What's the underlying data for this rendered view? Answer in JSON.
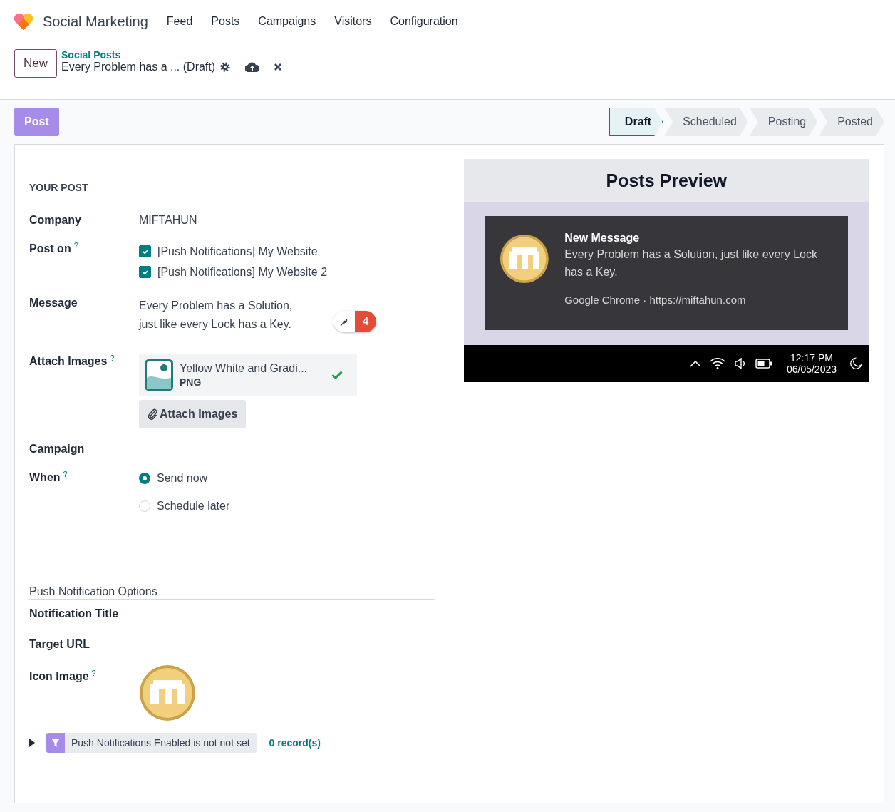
{
  "app": {
    "name": "Social Marketing",
    "menu": [
      "Feed",
      "Posts",
      "Campaigns",
      "Visitors",
      "Configuration"
    ]
  },
  "control_panel": {
    "new_button": "New",
    "breadcrumb": "Social Posts",
    "record_title": "Every Problem has a ... (Draft)"
  },
  "action_button": "Post",
  "stages": [
    {
      "label": "Draft",
      "selected": true
    },
    {
      "label": "Scheduled",
      "selected": false
    },
    {
      "label": "Posting",
      "selected": false
    },
    {
      "label": "Posted",
      "selected": false
    }
  ],
  "form": {
    "section_title": "YOUR POST",
    "company": {
      "label": "Company",
      "value": "MIFTAHUN"
    },
    "post_on": {
      "label": "Post on",
      "help": "?",
      "accounts": [
        {
          "label": "[Push Notifications] My Website",
          "checked": true
        },
        {
          "label": "[Push Notifications] My Website 2",
          "checked": true
        }
      ]
    },
    "message": {
      "label": "Message",
      "lines": [
        "Every Problem has a Solution,",
        "just like every Lock has a Key."
      ],
      "counter": "4"
    },
    "attach_images": {
      "label": "Attach Images",
      "help": "?",
      "attachment": {
        "name": "Yellow White and Gradi...",
        "type": "PNG"
      },
      "button": "Attach Images"
    },
    "campaign": {
      "label": "Campaign"
    },
    "when": {
      "label": "When",
      "help": "?",
      "options": [
        {
          "label": "Send now",
          "selected": true
        },
        {
          "label": "Schedule later",
          "selected": false
        }
      ]
    },
    "push_section_title": "Push Notification Options",
    "notification_title": {
      "label": "Notification Title"
    },
    "target_url": {
      "label": "Target URL"
    },
    "icon_image": {
      "label": "Icon Image",
      "help": "?"
    },
    "filter": {
      "text": "Push Notifications Enabled is not not set",
      "records": "0 record(s)"
    }
  },
  "preview": {
    "title": "Posts Preview",
    "notification": {
      "title": "New Message",
      "body": "Every Problem has a Solution, just like every Lock has a Key.",
      "source": "Google Chrome · https://miftahun.com"
    },
    "taskbar": {
      "time": "12:17 PM",
      "date": "06/05/2023"
    }
  }
}
